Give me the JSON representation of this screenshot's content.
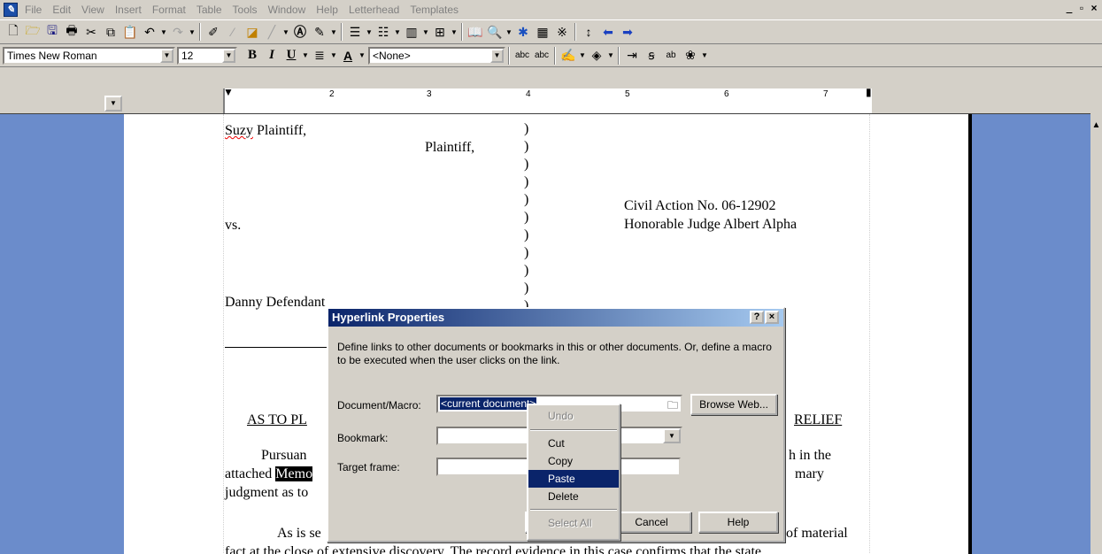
{
  "menubar": {
    "items": [
      "File",
      "Edit",
      "View",
      "Insert",
      "Format",
      "Table",
      "Tools",
      "Window",
      "Help",
      "Letterhead",
      "Templates"
    ],
    "win_controls": [
      "_",
      "̆",
      "x"
    ]
  },
  "toolbar2": {
    "font": "Times New Roman",
    "size": "12",
    "style": "<None>"
  },
  "ruler": {
    "numbers": [
      "2",
      "3",
      "4",
      "5",
      "6",
      "7"
    ]
  },
  "document": {
    "caption_plaintiff_name": "Suzy Plaintiff,",
    "caption_plaintiff_role": "Plaintiff,",
    "caption_vs": "vs.",
    "caption_defendant": "Danny Defendant",
    "case_number": "Civil Action No. 06-12902",
    "judge": "Honorable Judge Albert Alpha",
    "heading_left": "AS TO PL",
    "heading_right": "RELIEF",
    "para1_start": "Pursuan",
    "para1_end": "h in the",
    "para2_start": "attached ",
    "para2_hl": "Memo",
    "para2_end": "mary",
    "para3_start": "judgment as to",
    "para4_start": "As is se",
    "para4_end": "of material",
    "para5": "fact at the close of extensive discovery.  The record evidence in this case confirms that the state"
  },
  "dialog": {
    "title": "Hyperlink Properties",
    "help_btn": "?",
    "close_btn": "×",
    "description": "Define links to other documents or bookmarks in this or other documents. Or, define a macro to be executed when the user clicks on the link.",
    "doc_macro_label": "Document/Macro:",
    "doc_macro_value": "<current document>",
    "bookmark_label": "Bookmark:",
    "target_label": "Target frame:",
    "browse_web": "Browse Web...",
    "cancel": "Cancel",
    "help": "Help"
  },
  "context_menu": {
    "undo": "Undo",
    "cut": "Cut",
    "copy": "Copy",
    "paste": "Paste",
    "delete": "Delete",
    "select_all": "Select All"
  }
}
